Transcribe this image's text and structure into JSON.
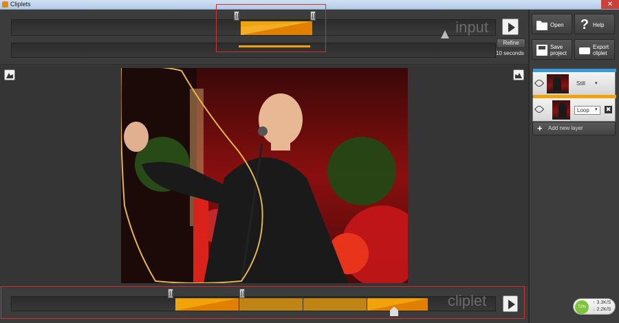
{
  "window": {
    "title": "Cliplets",
    "close_glyph": "✕"
  },
  "input_timeline": {
    "label": "input",
    "refine_label": "Refine",
    "duration_text": "10 seconds"
  },
  "cliplet_timeline": {
    "label": "cliplet"
  },
  "toolbar": {
    "open_label": "Open",
    "help_label": "Help",
    "save_label": "Save project",
    "export_label": "Export cliplet"
  },
  "layers": [
    {
      "mode": "Still",
      "bar_color": "#3a9ad9"
    },
    {
      "mode": "Loop",
      "bar_color": "#f0a30a"
    }
  ],
  "add_layer_label": "Add new layer",
  "network": {
    "percent": "72%",
    "upload": "3.3K/S",
    "download": "2.2K/S"
  },
  "colors": {
    "accent": "#f0a30a",
    "frame": "#d03030",
    "mask_outline": "#e8b64a"
  }
}
